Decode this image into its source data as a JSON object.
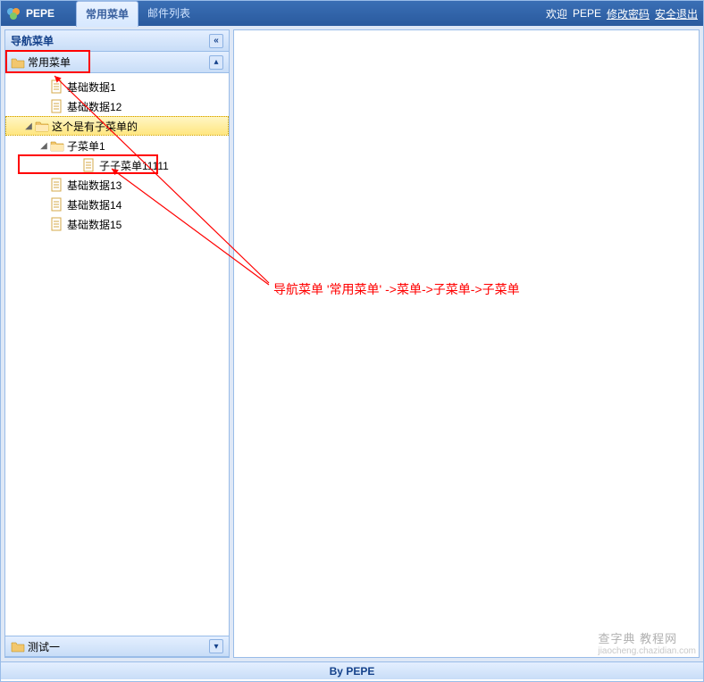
{
  "header": {
    "brand": "PEPE",
    "tabs": [
      {
        "label": "常用菜单",
        "active": true
      },
      {
        "label": "邮件列表",
        "active": false
      }
    ],
    "welcome_prefix": "欢迎",
    "welcome_user": "PEPE",
    "link_pwd": "修改密码",
    "link_exit": "安全退出"
  },
  "sidebar": {
    "title": "导航菜单",
    "accordion": [
      {
        "label": "常用菜单",
        "expanded": true
      },
      {
        "label": "测试一",
        "expanded": false
      }
    ],
    "tree": [
      {
        "type": "leaf",
        "indent": 36,
        "label": "基础数据1"
      },
      {
        "type": "leaf",
        "indent": 36,
        "label": "基础数据12"
      },
      {
        "type": "branch",
        "indent": 18,
        "label": "这个是有子菜单的",
        "expanded": true,
        "selected": true
      },
      {
        "type": "branch",
        "indent": 36,
        "label": "子菜单1",
        "expanded": true,
        "selected": false
      },
      {
        "type": "leaf",
        "indent": 72,
        "label": "子子菜单11111"
      },
      {
        "type": "leaf",
        "indent": 36,
        "label": "基础数据13"
      },
      {
        "type": "leaf",
        "indent": 36,
        "label": "基础数据14"
      },
      {
        "type": "leaf",
        "indent": 36,
        "label": "基础数据15"
      }
    ]
  },
  "content": {
    "annotation": "导航菜单 '常用菜单' ->菜单->子菜单->子菜单"
  },
  "footer": {
    "text": "By PEPE"
  },
  "watermark": {
    "line1": "查字典 教程网",
    "line2": "jiaocheng.chazidian.com"
  },
  "colors": {
    "accent": "#15428b",
    "border": "#99bce8",
    "highlight": "red"
  }
}
